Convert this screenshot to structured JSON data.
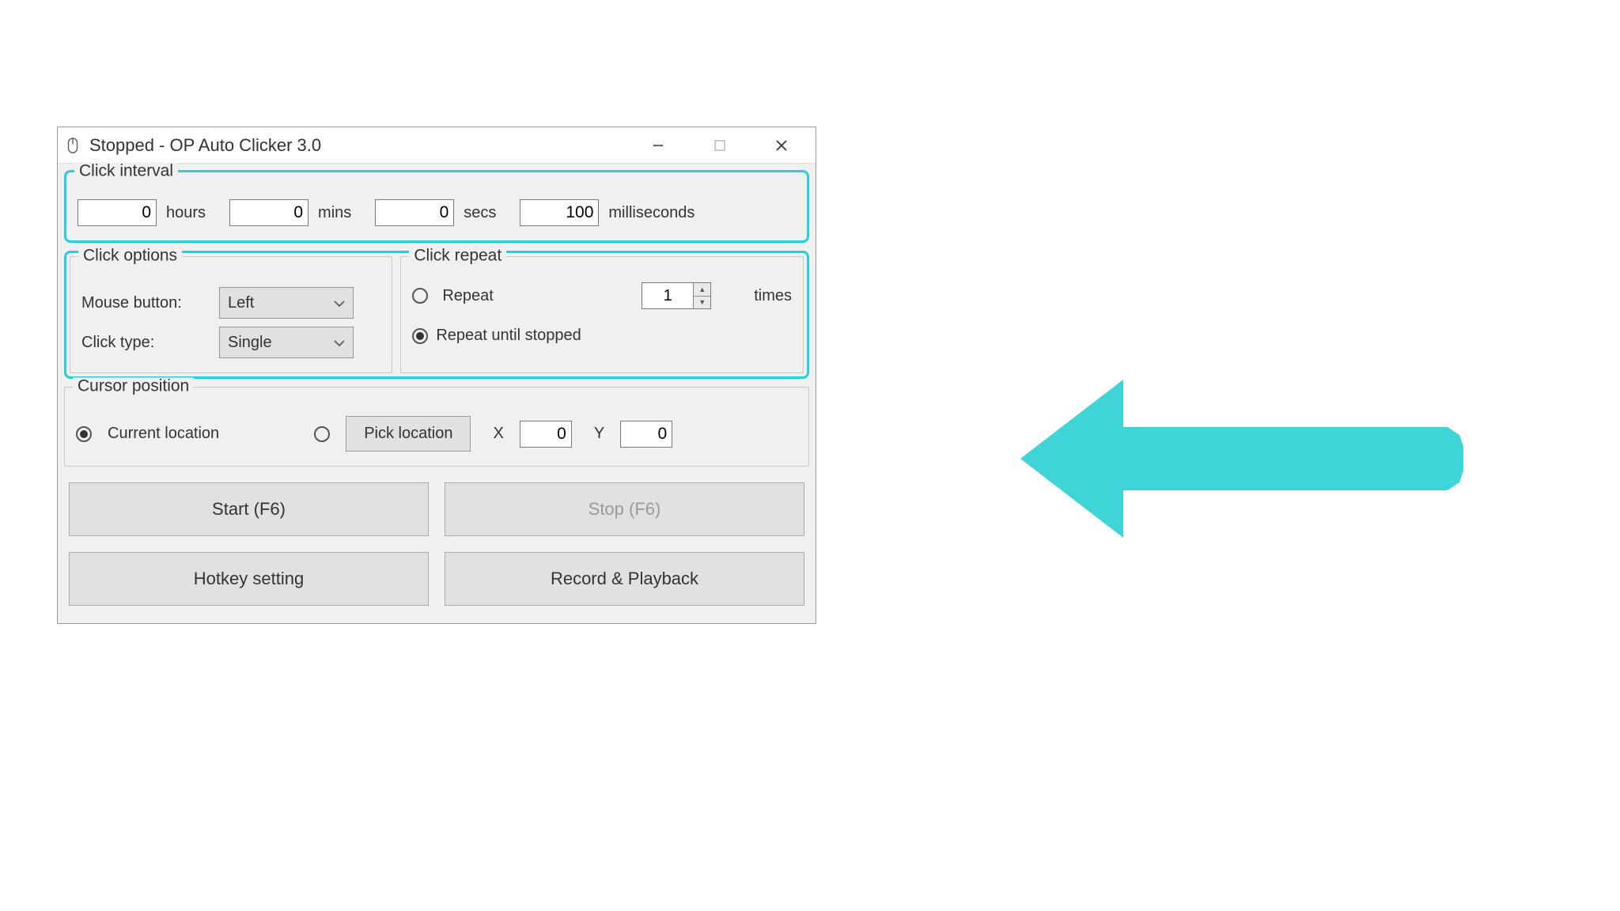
{
  "window": {
    "title": "Stopped - OP Auto Clicker 3.0"
  },
  "interval": {
    "legend": "Click interval",
    "hours": "0",
    "hours_unit": "hours",
    "mins": "0",
    "mins_unit": "mins",
    "secs": "0",
    "secs_unit": "secs",
    "ms": "100",
    "ms_unit": "milliseconds"
  },
  "options": {
    "legend": "Click options",
    "mouse_label": "Mouse button:",
    "mouse_value": "Left",
    "type_label": "Click type:",
    "type_value": "Single"
  },
  "repeat": {
    "legend": "Click repeat",
    "repeat_label": "Repeat",
    "repeat_count": "1",
    "times_label": "times",
    "until_label": "Repeat until stopped"
  },
  "cursor": {
    "legend": "Cursor position",
    "current_label": "Current location",
    "pick_label": "Pick location",
    "x_label": "X",
    "x_value": "0",
    "y_label": "Y",
    "y_value": "0"
  },
  "buttons": {
    "start": "Start (F6)",
    "stop": "Stop (F6)",
    "hotkey": "Hotkey setting",
    "record": "Record & Playback"
  },
  "annotation": {
    "arrow_color": "#3fd5d8"
  }
}
